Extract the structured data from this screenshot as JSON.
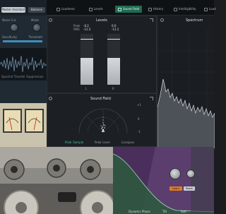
{
  "left_top": {
    "tabs": [
      "Master Assistant",
      "Balance"
    ],
    "labels": [
      "Noise Cut",
      "Mode",
      "Sensitivity",
      "Threshold"
    ]
  },
  "left_wave": {
    "caption": "Spectral Transfer Suppression"
  },
  "toolbar": {
    "items": [
      {
        "label": "Loudness",
        "icon": "loudness-icon",
        "active": false
      },
      {
        "label": "Levels",
        "icon": "levels-icon",
        "active": false
      },
      {
        "label": "Sound Field",
        "icon": "sound-field-icon",
        "active": true
      },
      {
        "label": "History",
        "icon": "history-icon",
        "active": false
      },
      {
        "label": "Intelligibility",
        "icon": "intelligibility-icon",
        "active": false
      },
      {
        "label": "Loud",
        "icon": "loud-icon",
        "active": false
      }
    ]
  },
  "levels": {
    "title": "Levels",
    "left": {
      "label": "Peak",
      "peak": "-0.2",
      "rms": "-11.5",
      "rms_label": "RMS"
    },
    "right": {
      "label": "L",
      "peak": "0.0",
      "rms": "-11.1"
    },
    "channels": [
      "L",
      "R"
    ]
  },
  "sound_field": {
    "title": "Sound Field",
    "modes": [
      "Polar Sample",
      "Polar Level",
      "Lissajous"
    ],
    "active_mode": "Polar Sample",
    "scale_top": "+1",
    "scale_mid": "0",
    "scale_bottom": "-1"
  },
  "spectrum": {
    "title": "Spectrum"
  },
  "eq": {
    "footer_labels": [
      "Dynamic Phase",
      "Tilt",
      "Soft"
    ],
    "buttons": [
      "Learn",
      "Reset"
    ]
  },
  "colors": {
    "accent": "#1f6b52",
    "panel": "#1c2025",
    "eq_purple": "#5b3e6e",
    "eq_green": "#2c5a3c"
  }
}
